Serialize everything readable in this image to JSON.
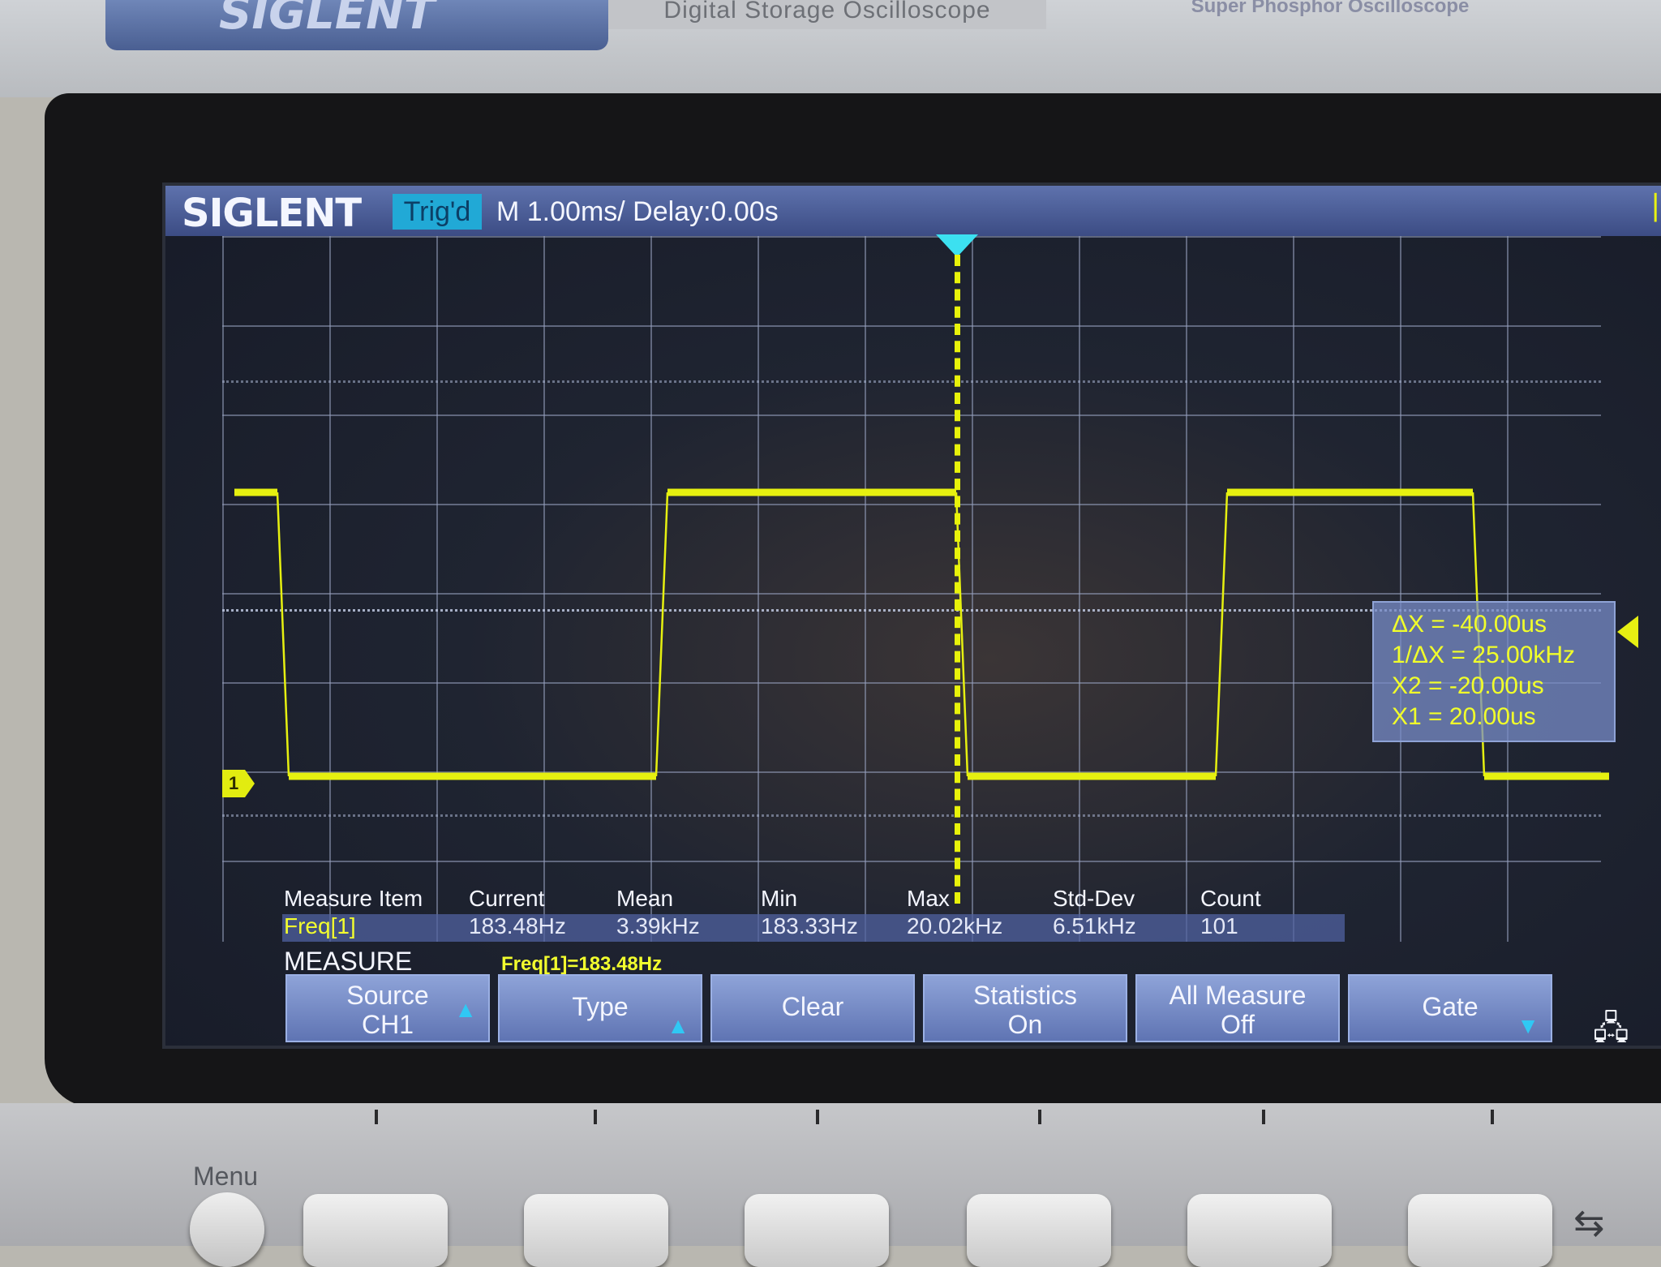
{
  "instrument": {
    "brand": "SIGLENT",
    "caption": "Digital Storage Oscilloscope",
    "caption_right": "Super Phosphor Oscilloscope",
    "menu_key_label": "Menu"
  },
  "header": {
    "logo": "SIGLENT",
    "trigger_status": "Trig'd",
    "timebase": "M 1.00ms/ Delay:0.00s"
  },
  "channel": {
    "marker_label": "1",
    "trace_color": "#e6f010"
  },
  "waveform": {
    "type": "square",
    "levels": [
      "high",
      "low",
      "high",
      "low",
      "high",
      "low"
    ]
  },
  "cursor_readout": {
    "delta_x": "ΔX = -40.00us",
    "inv_delta_x": "1/ΔX = 25.00kHz",
    "x2": "X2 = -20.00us",
    "x1": "X1 = 20.00us"
  },
  "measurement": {
    "columns": [
      "Measure Item",
      "Current",
      "Mean",
      "Min",
      "Max",
      "Std-Dev",
      "Count"
    ],
    "row": {
      "item": "Freq[1]",
      "current": "183.48Hz",
      "mean": "3.39kHz",
      "min": "183.33Hz",
      "max": "20.02kHz",
      "std_dev": "6.51kHz",
      "count": "101"
    },
    "title": "MEASURE",
    "summary": "Freq[1]=183.48Hz"
  },
  "softkeys": [
    {
      "line1": "Source",
      "line2": "CH1",
      "arrow": "up"
    },
    {
      "line1": "Type",
      "line2": "",
      "arrow": "up"
    },
    {
      "line1": "Clear",
      "line2": "",
      "arrow": ""
    },
    {
      "line1": "Statistics",
      "line2": "On",
      "arrow": ""
    },
    {
      "line1": "All Measure",
      "line2": "Off",
      "arrow": ""
    },
    {
      "line1": "Gate",
      "line2": "",
      "arrow": "down"
    }
  ],
  "icons": {
    "network": "network-icon",
    "usb": "usb-icon"
  },
  "colors": {
    "trace": "#e6f010",
    "header_bar": "#4a5c98",
    "trigger_badge": "#21a9d6",
    "softkey": "#7488c4"
  }
}
